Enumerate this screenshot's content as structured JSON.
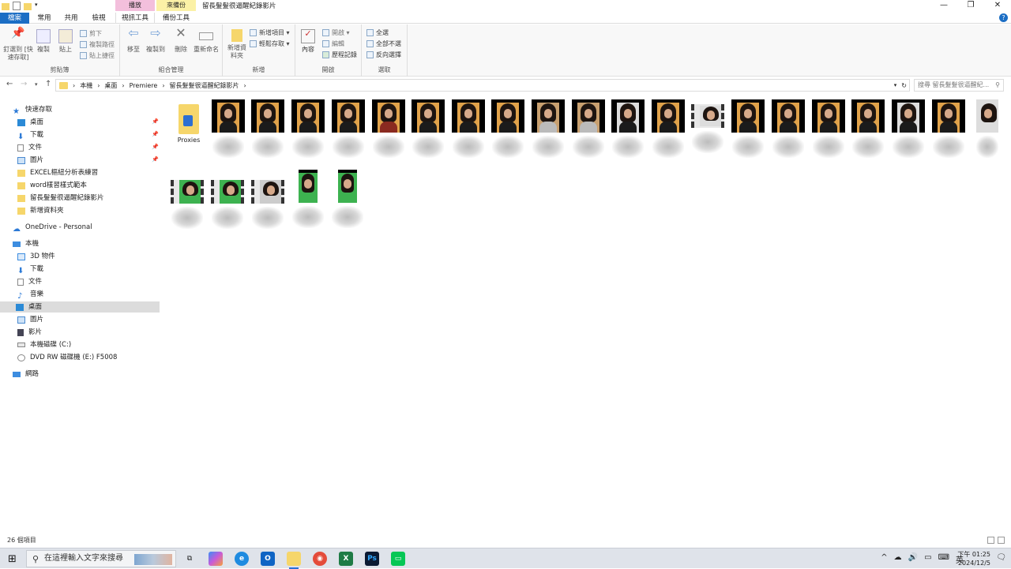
{
  "window": {
    "title": "留長髮髮很逼醒紀錄影片",
    "context_tabs": [
      "播放",
      "來備份"
    ],
    "tabs": [
      "檔案",
      "常用",
      "共用",
      "檢視",
      "視訊工具",
      "備份工具"
    ],
    "controls": [
      "—",
      "❐",
      "✕"
    ]
  },
  "ribbon": {
    "clipboard": {
      "label": "剪貼簿",
      "pin": "釘選到 [快速存取]",
      "copy": "複製",
      "paste": "貼上",
      "cut": "剪下",
      "copy_path": "複製路徑",
      "paste_shortcut": "貼上捷徑"
    },
    "organize": {
      "label": "組合管理",
      "move_to": "移至",
      "copy_to": "複製到",
      "delete": "刪除",
      "rename": "重新命名"
    },
    "new": {
      "label": "新增",
      "new_folder": "新增資料夾",
      "new_item": "新增項目 ▾",
      "easy_access": "輕鬆存取 ▾"
    },
    "open": {
      "label": "開啟",
      "properties": "內容",
      "open": "開啟 ▾",
      "edit": "編輯",
      "history": "歷程記錄"
    },
    "select": {
      "label": "選取",
      "select_all": "全選",
      "select_none": "全部不選",
      "invert": "反向選擇"
    }
  },
  "address": {
    "segments": [
      "本機",
      "桌面",
      "Premiere",
      "留長髮髮很逼醒紀錄影片"
    ],
    "search_placeholder": "搜尋 留長髮髮很逼醒紀..."
  },
  "nav": {
    "quick_access": "快速存取",
    "quick_items": [
      "桌面",
      "下載",
      "文件",
      "圖片",
      "EXCEL樞紐分析表練習",
      "word樣習樣式範本",
      "留長髮髮很逼醒紀錄影片",
      "新增資料夾"
    ],
    "onedrive": "OneDrive - Personal",
    "this_pc": "本機",
    "pc_items": [
      "3D 物件",
      "下載",
      "文件",
      "音樂",
      "桌面",
      "圖片",
      "影片",
      "本機磁碟 (C:)",
      "DVD RW 磁碟機 (E:) F5008"
    ],
    "network": "網路",
    "selected": "桌面"
  },
  "content": {
    "folder_label": "Proxies",
    "file_count": 25
  },
  "status": {
    "count": "26 個項目"
  },
  "taskbar": {
    "search_placeholder": "在這裡輸入文字來搜尋",
    "ime": "英",
    "time": "下午 01:25",
    "date": "2024/12/5"
  },
  "colors": {
    "accent": "#1c6ec4",
    "folder": "#f6d66b",
    "thumb_bg": "#e0a24a",
    "green_screen": "#3db250"
  }
}
